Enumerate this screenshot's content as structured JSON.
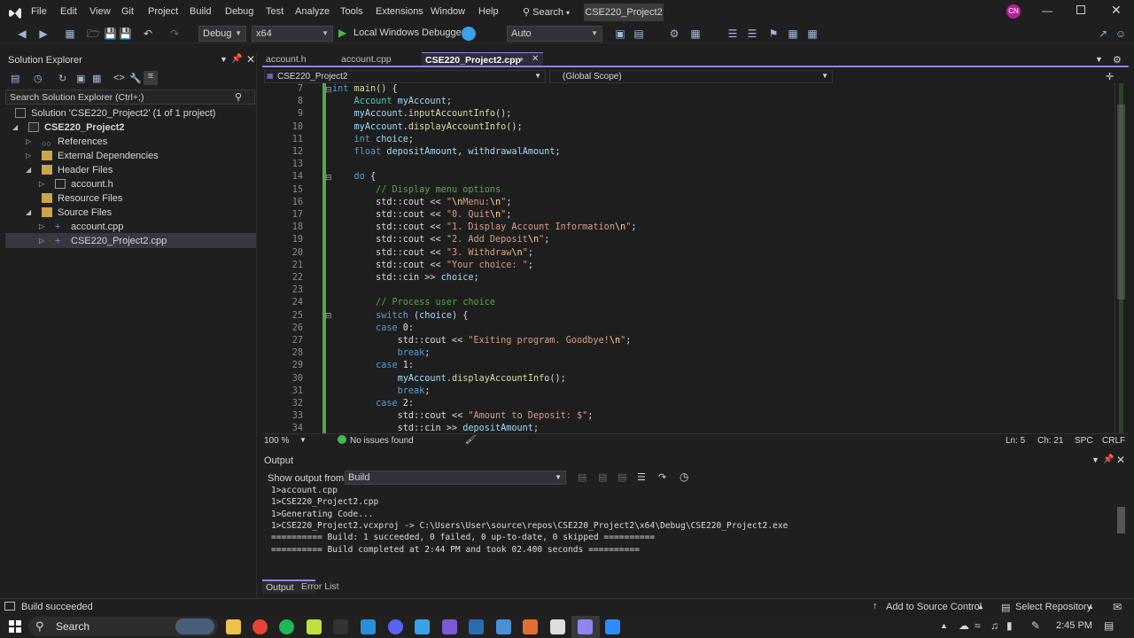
{
  "menu": [
    "File",
    "Edit",
    "View",
    "Git",
    "Project",
    "Build",
    "Debug",
    "Test",
    "Analyze",
    "Tools",
    "Extensions",
    "Window",
    "Help"
  ],
  "search_label": "Search",
  "project_title": "CSE220_Project2",
  "avatar": "CN",
  "toolbar": {
    "config": "Debug",
    "platform": "x64",
    "debugger": "Local Windows Debugger",
    "auto": "Auto"
  },
  "solution_explorer": {
    "title": "Solution Explorer",
    "search_placeholder": "Search Solution Explorer (Ctrl+;)",
    "solution": "Solution 'CSE220_Project2' (1 of 1 project)",
    "project": "CSE220_Project2",
    "items": [
      {
        "label": "References"
      },
      {
        "label": "External Dependencies"
      },
      {
        "label": "Header Files"
      },
      {
        "label": "account.h"
      },
      {
        "label": "Resource Files"
      },
      {
        "label": "Source Files"
      },
      {
        "label": "account.cpp"
      },
      {
        "label": "CSE220_Project2.cpp"
      }
    ]
  },
  "tabs": [
    "account.h",
    "account.cpp",
    "CSE220_Project2.cpp"
  ],
  "nav": {
    "project": "CSE220_Project2",
    "scope": "(Global Scope)"
  },
  "code": {
    "line_numbers": [
      "7",
      "8",
      "9",
      "10",
      "11",
      "12",
      "13",
      "14",
      "15",
      "16",
      "17",
      "18",
      "19",
      "20",
      "21",
      "22",
      "23",
      "24",
      "25",
      "26",
      "27",
      "28",
      "29",
      "30",
      "31",
      "32",
      "33",
      "34"
    ],
    "lines": [
      "int main() {",
      "    Account myAccount;",
      "    myAccount.inputAccountInfo();",
      "    myAccount.displayAccountInfo();",
      "    int choice;",
      "    float depositAmount, withdrawalAmount;",
      "",
      "    do {",
      "        // Display menu options",
      "        std::cout << \"\\nMenu:\\n\";",
      "        std::cout << \"0. Quit\\n\";",
      "        std::cout << \"1. Display Account Information\\n\";",
      "        std::cout << \"2. Add Deposit\\n\";",
      "        std::cout << \"3. Withdraw\\n\";",
      "        std::cout << \"Your choice: \";",
      "        std::cin >> choice;",
      "",
      "        // Process user choice",
      "        switch (choice) {",
      "        case 0:",
      "            std::cout << \"Exiting program. Goodbye!\\n\";",
      "            break;",
      "        case 1:",
      "            myAccount.displayAccountInfo();",
      "            break;",
      "        case 2:",
      "            std::cout << \"Amount to Deposit: $\";",
      "            std::cin >> depositAmount;"
    ]
  },
  "editor_status": {
    "zoom": "100 %",
    "issues": "No issues found",
    "ln": "Ln: 5",
    "ch": "Ch: 21",
    "spc": "SPC",
    "crlf": "CRLF"
  },
  "output": {
    "title": "Output",
    "show_from_label": "Show output from:",
    "source": "Build",
    "lines": [
      "1>account.cpp",
      "1>CSE220_Project2.cpp",
      "1>Generating Code...",
      "1>CSE220_Project2.vcxproj -> C:\\Users\\User\\source\\repos\\CSE220_Project2\\x64\\Debug\\CSE220_Project2.exe",
      "========== Build: 1 succeeded, 0 failed, 0 up-to-date, 0 skipped ==========",
      "========== Build completed at 2:44 PM and took 02.400 seconds =========="
    ],
    "tabs": [
      "Output",
      "Error List"
    ]
  },
  "status": {
    "message": "Build succeeded",
    "source_control": "Add to Source Control",
    "repository": "Select Repository"
  },
  "taskbar": {
    "search": "Search",
    "time": "2:45 PM"
  },
  "colors": {
    "accent": "#9184ee",
    "avatar": "#b4219b",
    "keyword": "#569cd6",
    "string": "#d69d85",
    "comment": "#57a64a"
  }
}
